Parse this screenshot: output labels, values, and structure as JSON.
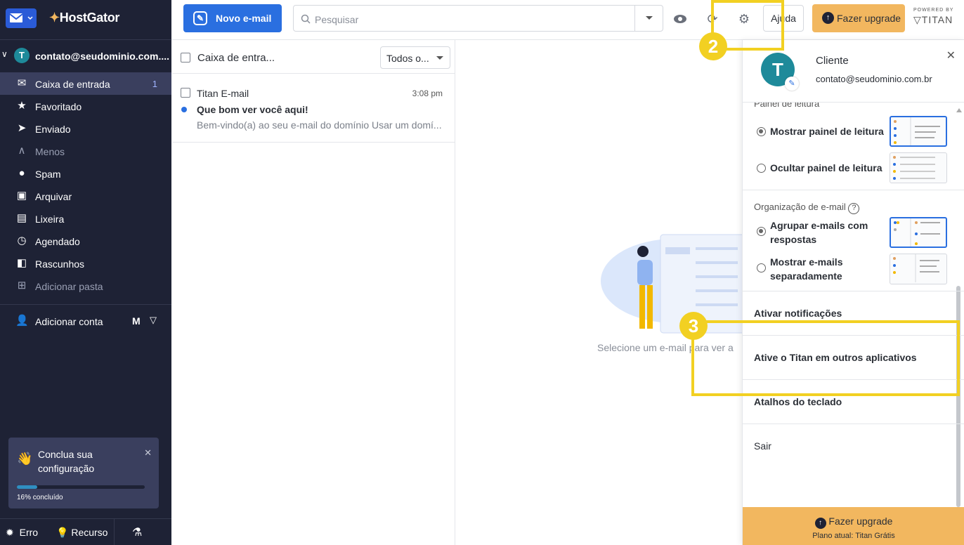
{
  "brand": {
    "name": "HostGator"
  },
  "account": {
    "avatar_letter": "T",
    "email": "contato@seudominio.com...."
  },
  "nav": [
    {
      "label": "Caixa de entrada",
      "badge": "1"
    },
    {
      "label": "Favoritado"
    },
    {
      "label": "Enviado"
    },
    {
      "label": "Menos"
    },
    {
      "label": "Spam"
    },
    {
      "label": "Arquivar"
    },
    {
      "label": "Lixeira"
    },
    {
      "label": "Agendado"
    },
    {
      "label": "Rascunhos"
    },
    {
      "label": "Adicionar pasta"
    }
  ],
  "add_account": {
    "label": "Adicionar conta"
  },
  "setup_card": {
    "title_line1": "Conclua sua",
    "title_line2": "configuração",
    "progress_label": "16% concluído",
    "progress": 0.16
  },
  "bottom_bar": {
    "bug": "Erro",
    "feature": "Recurso"
  },
  "toolbar": {
    "new_email": "Novo e-mail",
    "search_placeholder": "Pesquisar",
    "help": "Ajuda",
    "upgrade": "Fazer upgrade",
    "powered_by": "POWERED BY",
    "titan": "TITAN"
  },
  "list": {
    "folder_title": "Caixa de entra...",
    "filter": "Todos o...",
    "emails": [
      {
        "sender": "Titan E-mail",
        "time": "3:08 pm",
        "subject": "Que bom ver você aqui!",
        "preview": "Bem-vindo(a) ao seu e-mail do domínio Usar um domí..."
      }
    ]
  },
  "reading_pane": {
    "empty_message": "Selecione um e-mail para ver a"
  },
  "panel": {
    "user_name": "Cliente",
    "user_email": "contato@seudominio.com.br",
    "avatar_letter": "T",
    "reading_section": "Painel de leitura",
    "reading_options": [
      "Mostrar painel de leitura",
      "Ocultar painel de leitura"
    ],
    "org_section": "Organização de e-mail",
    "org_options": [
      [
        "Agrupar e-mails com",
        "respostas"
      ],
      [
        "Mostrar e-mails",
        "separadamente"
      ]
    ],
    "items": [
      "Ativar notificações",
      "Ative o Titan em outros aplicativos",
      "Atalhos do teclado",
      "Sair"
    ],
    "upgrade": "Fazer upgrade",
    "plan": "Plano atual: Titan Grátis"
  },
  "annotations": {
    "step2": "2",
    "step3": "3"
  },
  "colors": {
    "sidebar": "#1e2235",
    "primary": "#2a6fe0",
    "upgrade": "#f2b75f",
    "highlight": "#f2d022"
  }
}
